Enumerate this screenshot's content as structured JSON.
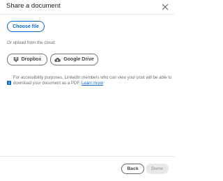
{
  "dialog": {
    "title": "Share a document"
  },
  "upload": {
    "choose_file_label": "Choose file",
    "cloud_label": "Or upload from the cloud:",
    "dropbox_label": "Dropbox",
    "google_drive_label": "Google Drive"
  },
  "notice": {
    "text": "For accessibility purposes, LinkedIn members who can view your post will be able to download your document as a PDF.",
    "link_label": "Learn more"
  },
  "footer": {
    "back_label": "Back",
    "done_label": "Done",
    "done_enabled": false
  },
  "colors": {
    "accent": "#0a66c2",
    "info_icon": "#0a66c2",
    "disabled_bg": "#e8e8e8"
  },
  "icons": {
    "close": "close-icon",
    "dropbox": "dropbox-icon",
    "google_drive": "cloud-icon",
    "info": "info-icon"
  }
}
